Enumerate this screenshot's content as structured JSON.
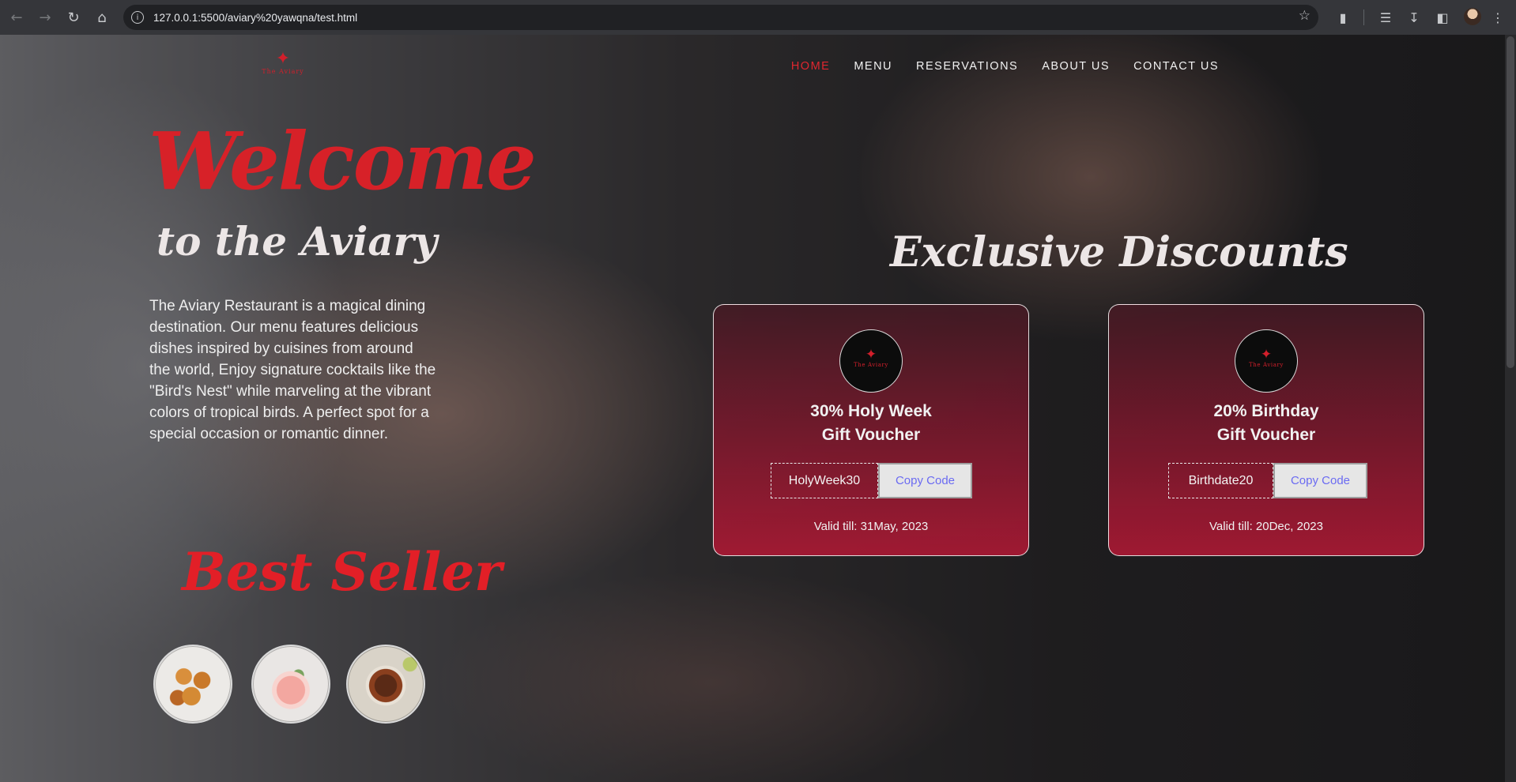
{
  "browser": {
    "url": "127.0.0.1:5500/aviary%20yawqna/test.html",
    "icons": [
      "back-icon",
      "forward-icon",
      "reload-icon",
      "home-icon",
      "site-info-icon",
      "bookmark-star-icon",
      "extensions-icon",
      "media-icon",
      "download-icon",
      "sidebar-icon",
      "profile-avatar",
      "menu-icon"
    ]
  },
  "brand": {
    "logo_text": "The Aviary",
    "accent": "#d72128"
  },
  "nav": {
    "items": [
      "HOME",
      "MENU",
      "RESERVATIONS",
      "ABOUT US",
      "CONTACT US"
    ],
    "active": "HOME"
  },
  "hero": {
    "title": "Welcome",
    "subtitle": "to the Aviary",
    "description": "The Aviary Restaurant is a magical dining destination. Our menu features delicious dishes inspired by cuisines from around the world, Enjoy signature cocktails like the \"Bird's Nest\" while marveling at the vibrant colors of tropical birds. A perfect spot for a special occasion or romantic dinner."
  },
  "best_seller": {
    "title": "Best Seller",
    "items": [
      "pastry-bites-image",
      "pink-cocktail-image",
      "braised-dish-image"
    ]
  },
  "discounts": {
    "title": "Exclusive Discounts",
    "cards": [
      {
        "title_line1": "30% Holy Week",
        "title_line2": "Gift Voucher",
        "code": "HolyWeek30",
        "button": "Copy Code",
        "valid": "Valid till: 31May, 2023"
      },
      {
        "title_line1": "20% Birthday",
        "title_line2": "Gift Voucher",
        "code": "Birthdate20",
        "button": "Copy Code",
        "valid": "Valid till: 20Dec, 2023"
      }
    ]
  }
}
